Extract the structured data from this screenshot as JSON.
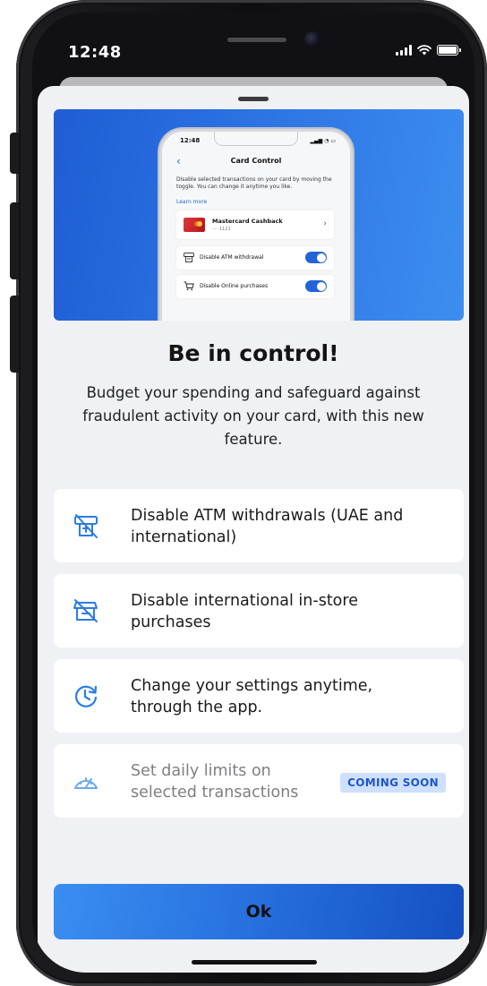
{
  "status_bar": {
    "time": "12:48"
  },
  "hero": {
    "mini_phone": {
      "time": "12:48",
      "back": "‹",
      "title": "Card Control",
      "description": "Disable selected transactions on your card by moving the toggle. You can change it anytime you like.",
      "learn_more": "Learn more",
      "card": {
        "name": "Mastercard Cashback",
        "number": "···· 1121",
        "chevron": "›"
      },
      "rows": [
        {
          "label": "Disable ATM withdrawal",
          "icon": "atm-icon",
          "enabled": true
        },
        {
          "label": "Disable Online purchases",
          "icon": "cart-icon",
          "enabled": true
        }
      ]
    }
  },
  "headline": "Be in control!",
  "subtext": "Budget your spending and safeguard against fraudulent activity on your card, with this new feature.",
  "features": [
    {
      "text": "Disable ATM withdrawals (UAE and international)",
      "icon": "atm-disabled-icon"
    },
    {
      "text": "Disable international in-store purchases",
      "icon": "store-purchase-disabled-icon"
    },
    {
      "text": "Change your settings anytime, through the app.",
      "icon": "clock-refresh-icon"
    },
    {
      "text": "Set daily limits on selected transactions",
      "icon": "speedometer-icon",
      "badge": "COMING SOON"
    }
  ],
  "ok_button": {
    "label": "Ok"
  },
  "colors": {
    "accent": "#2872e0",
    "icon_blue": "#2b7de3",
    "badge_bg": "#cfe0ff",
    "badge_text": "#1e56c7",
    "sheet_bg": "#f0f1f4"
  }
}
